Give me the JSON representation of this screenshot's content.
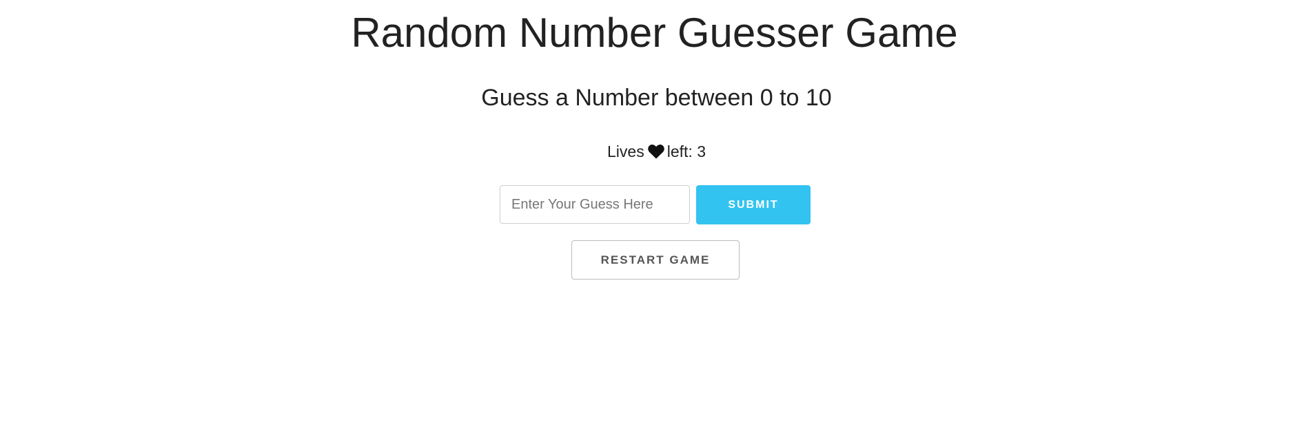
{
  "header": {
    "title": "Random Number Guesser Game",
    "subtitle": "Guess a Number between 0 to 10"
  },
  "lives": {
    "prefix": "Lives",
    "icon": "heart-icon",
    "suffix": "left:",
    "count": "3"
  },
  "guess": {
    "placeholder": "Enter Your Guess Here",
    "value": ""
  },
  "buttons": {
    "submit_label": "SUBMIT",
    "restart_label": "RESTART GAME"
  },
  "colors": {
    "accent": "#33c3f0",
    "text": "#222222",
    "secondary_text": "#555555"
  }
}
